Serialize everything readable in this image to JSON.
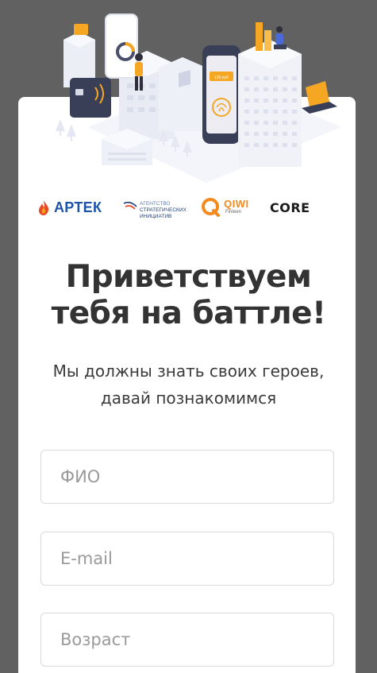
{
  "partners": {
    "artek": "АРТЕК",
    "asi_lines": [
      "АГЕНТСТВО",
      "СТРАТЕГИЧЕСКИХ",
      "ИНИЦИАТИВ"
    ],
    "qiwi": "QIWI",
    "qiwi_sub": "Finteen",
    "core": "CORE"
  },
  "hero": {
    "phone_amount": "100 руб"
  },
  "title_lines": [
    "Приветствуем",
    "тебя на баттле!"
  ],
  "subtitle_lines": [
    "Мы должны знать своих героев,",
    "давай познакомимся"
  ],
  "form": {
    "fio_placeholder": "ФИО",
    "email_placeholder": "E-mail",
    "age_placeholder": "Возраст"
  },
  "colors": {
    "backdrop": "#616161",
    "card": "#ffffff",
    "accent_orange": "#f5a623",
    "artek_blue": "#1f53a8",
    "qiwi_orange": "#f28a1e"
  }
}
